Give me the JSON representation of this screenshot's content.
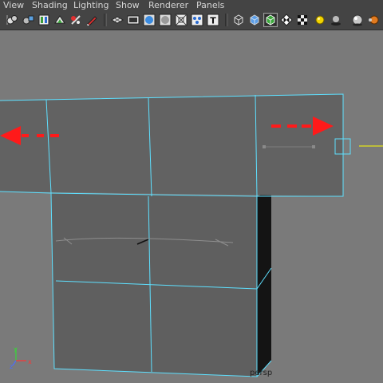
{
  "menu": {
    "items": [
      {
        "label": "View"
      },
      {
        "label": "Shading"
      },
      {
        "label": "Lighting"
      },
      {
        "label": "Show"
      },
      {
        "label": "Renderer"
      },
      {
        "label": "Panels"
      }
    ]
  },
  "toolbar": {
    "icons": [
      "select-camera-icon",
      "camera-attributes-icon",
      "bookmarks-icon",
      "image-plane-icon",
      "two-d-pan-icon",
      "grease-pencil-icon",
      "grid-icon",
      "film-gate-icon",
      "resolution-gate-icon",
      "gate-mask-icon",
      "field-chart-icon",
      "safe-action-icon",
      "safe-title-icon",
      "wireframe-icon",
      "smooth-shade-icon",
      "wireframe-on-shaded-icon",
      "textured-icon",
      "use-all-lights-icon",
      "shadows-icon",
      "high-quality-icon"
    ]
  },
  "viewport": {
    "camera_label": "persp",
    "background_color": "#7a7a7a",
    "mesh_face_color": "#5f5f5f",
    "selected_edge_color": "#5ee0ff",
    "shadow_face_color": "#111111",
    "arrow_color": "#ff1a1a",
    "manipulator_color": "#ffff00"
  },
  "axis": {
    "x_label": "x",
    "y_label": "y",
    "z_label": "z"
  }
}
